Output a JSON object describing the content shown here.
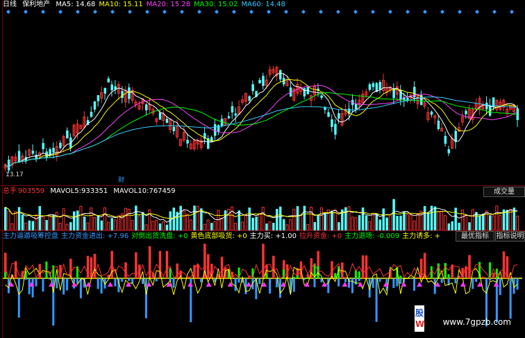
{
  "header": {
    "period": "日线",
    "stock": "保利地产",
    "ma": [
      {
        "label": "MA5:",
        "value": "14.68",
        "color": "#ffffff"
      },
      {
        "label": "MA10:",
        "value": "15.11",
        "color": "#ffff00"
      },
      {
        "label": "MA20:",
        "value": "15.28",
        "color": "#ff44ff"
      },
      {
        "label": "MA30:",
        "value": "15.02",
        "color": "#00ff00"
      },
      {
        "label": "MA60:",
        "value": "14.48",
        "color": "#33ccff"
      }
    ]
  },
  "price_panel": {
    "low_label": "13.17",
    "fin_marker": "财"
  },
  "volume_panel": {
    "total_label": "总手",
    "total_value": "903559",
    "mavol5_label": "MAVOL5:",
    "mavol5_value": "933351",
    "mavol10_label": "MAVOL10:",
    "mavol10_value": "767459",
    "dropdown_label": "成交量"
  },
  "indicator_panel": {
    "items": [
      {
        "text": "主力逼遁吸筹控盘",
        "color": "#3399ff"
      },
      {
        "text": "主力资金进出: +7.96",
        "color": "#3399ff"
      },
      {
        "text": "对倒出货洗盘: +0",
        "color": "#00ff00"
      },
      {
        "text": "黄色底部吸货: +0",
        "color": "#ffff00"
      },
      {
        "text": "主力买: +1.00",
        "color": "#ffffff"
      },
      {
        "text": "拉升资金: +0",
        "color": "#ff3333"
      },
      {
        "text": "主力退场: -0.009",
        "color": "#00ff00"
      },
      {
        "text": "主力诱多: +",
        "color": "#ffff00"
      }
    ],
    "btn_best": "最优指标",
    "btn_help": "指标说明"
  },
  "watermark": {
    "site": "www.7gpzb.com",
    "logo_top": "股",
    "logo_bottom": "W"
  },
  "colors": {
    "up": "#ff3333",
    "down": "#55ffff",
    "ma5": "#ffffff",
    "ma10": "#ffff00",
    "ma20": "#ff44ff",
    "ma30": "#00ff00",
    "ma60": "#33ccff"
  }
}
